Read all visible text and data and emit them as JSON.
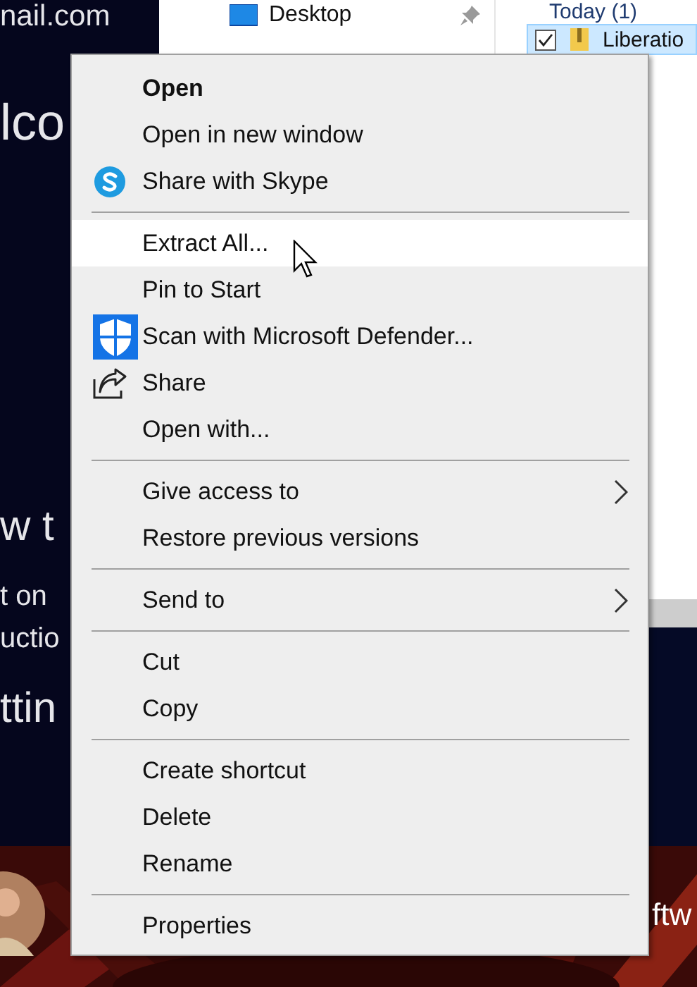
{
  "background_page": {
    "texts": [
      "nail.com",
      "lco",
      "w t",
      "t on",
      "uctio",
      "ttin"
    ],
    "footer_text": "ftw"
  },
  "explorer": {
    "nav_items": [
      {
        "label": "Desktop",
        "pinned": true
      }
    ],
    "group_header": "Today (1)",
    "files": [
      {
        "name": "Liberatio",
        "checked": true,
        "selected": true
      }
    ]
  },
  "context_menu": {
    "items": [
      {
        "kind": "item",
        "label": "Open",
        "default": true,
        "selected": false,
        "submenu": false
      },
      {
        "kind": "item",
        "label": "Open in new window",
        "default": false,
        "selected": false,
        "submenu": false
      },
      {
        "kind": "skype",
        "label": "Share with Skype",
        "default": false,
        "selected": false,
        "submenu": false
      },
      {
        "kind": "separator"
      },
      {
        "kind": "item",
        "label": "Extract All...",
        "default": false,
        "selected": true,
        "submenu": false
      },
      {
        "kind": "item",
        "label": "Pin to Start",
        "default": false,
        "selected": false,
        "submenu": false
      },
      {
        "kind": "defender",
        "label": "Scan with Microsoft Defender...",
        "default": false,
        "selected": false,
        "submenu": false
      },
      {
        "kind": "share",
        "label": "Share",
        "default": false,
        "selected": false,
        "submenu": false
      },
      {
        "kind": "item",
        "label": "Open with...",
        "default": false,
        "selected": false,
        "submenu": false
      },
      {
        "kind": "separator"
      },
      {
        "kind": "item",
        "label": "Give access to",
        "default": false,
        "selected": false,
        "submenu": true
      },
      {
        "kind": "item",
        "label": "Restore previous versions",
        "default": false,
        "selected": false,
        "submenu": false
      },
      {
        "kind": "separator"
      },
      {
        "kind": "item",
        "label": "Send to",
        "default": false,
        "selected": false,
        "submenu": true
      },
      {
        "kind": "separator"
      },
      {
        "kind": "item",
        "label": "Cut",
        "default": false,
        "selected": false,
        "submenu": false
      },
      {
        "kind": "item",
        "label": "Copy",
        "default": false,
        "selected": false,
        "submenu": false
      },
      {
        "kind": "separator"
      },
      {
        "kind": "item",
        "label": "Create shortcut",
        "default": false,
        "selected": false,
        "submenu": false
      },
      {
        "kind": "item",
        "label": "Delete",
        "default": false,
        "selected": false,
        "submenu": false
      },
      {
        "kind": "item",
        "label": "Rename",
        "default": false,
        "selected": false,
        "submenu": false
      },
      {
        "kind": "separator"
      },
      {
        "kind": "item",
        "label": "Properties",
        "default": false,
        "selected": false,
        "submenu": false
      }
    ]
  }
}
